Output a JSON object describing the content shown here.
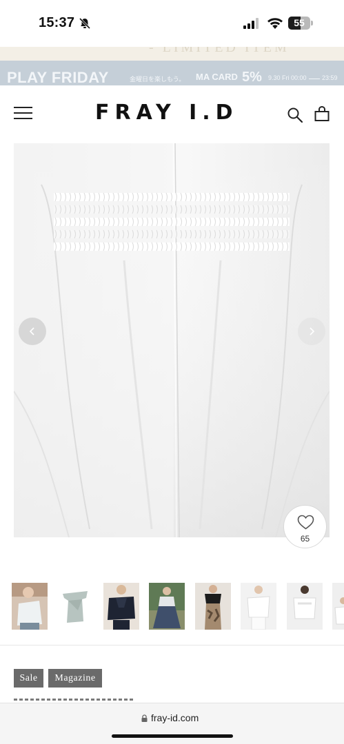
{
  "status_bar": {
    "time": "15:37",
    "battery_level": "55",
    "battery_fraction": 0.55
  },
  "promo": {
    "strip_text": "- LIMITED ITEM",
    "title": "PLAY FRIDAY",
    "subtitle": "金曜日を楽しもう。",
    "card": "MA CARD",
    "percent": "5%",
    "start": "9.30 Fri 00:00",
    "end": "23:59"
  },
  "header": {
    "logo": "FRAY I.D"
  },
  "product": {
    "favorite_count": "65",
    "thumbnail_count": 8
  },
  "tags": {
    "sale": "Sale",
    "magazine": "Magazine"
  },
  "browser": {
    "url": "fray-id.com"
  },
  "icons": {
    "menu": "hamburger-menu-icon",
    "search": "search-icon",
    "cart": "shopping-bag-icon",
    "favorite": "heart-icon",
    "prev": "chevron-left-icon",
    "next": "chevron-right-icon",
    "lock": "lock-icon"
  },
  "colors": {
    "promo_banner": "#c5cfd8",
    "tag_background": "#6a6a6a",
    "text": "#111111"
  }
}
